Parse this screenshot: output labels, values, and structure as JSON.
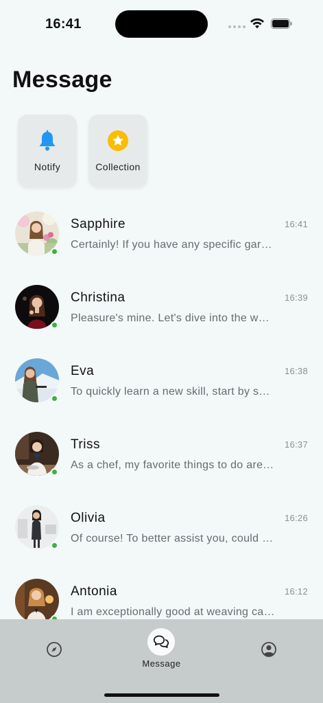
{
  "status_bar": {
    "time": "16:41",
    "icons": [
      "signal-dots-icon",
      "wifi-icon",
      "battery-icon"
    ]
  },
  "page": {
    "title": "Message"
  },
  "quick_actions": [
    {
      "label": "Notify",
      "icon": "bell-icon",
      "color": "#2196f3"
    },
    {
      "label": "Collection",
      "icon": "star-icon",
      "color": "#fbbc05"
    }
  ],
  "chats": [
    {
      "name": "Sapphire",
      "time": "16:41",
      "preview": "Certainly! If you have any specific gar…",
      "online": true
    },
    {
      "name": "Christina",
      "time": "16:39",
      "preview": "Pleasure's mine. Let's dive into the w…",
      "online": true
    },
    {
      "name": "Eva",
      "time": "16:38",
      "preview": "To quickly learn a new skill, start by s…",
      "online": true
    },
    {
      "name": "Triss",
      "time": "16:37",
      "preview": "As a chef, my favorite things to do are…",
      "online": true
    },
    {
      "name": "Olivia",
      "time": "16:26",
      "preview": "Of course! To better assist you, could …",
      "online": true
    },
    {
      "name": "Antonia",
      "time": "16:12",
      "preview": "I am exceptionally good at weaving ca…",
      "online": true
    }
  ],
  "tab_bar": {
    "tabs": [
      {
        "id": "discover",
        "icon": "compass-icon",
        "label": ""
      },
      {
        "id": "message",
        "icon": "chat-bubbles-icon",
        "label": "Message",
        "active": true
      },
      {
        "id": "profile",
        "icon": "user-circle-icon",
        "label": ""
      }
    ]
  },
  "colors": {
    "background": "#f3f8f8",
    "online": "#3cb043",
    "tab_bar": "#c6cbcb"
  }
}
